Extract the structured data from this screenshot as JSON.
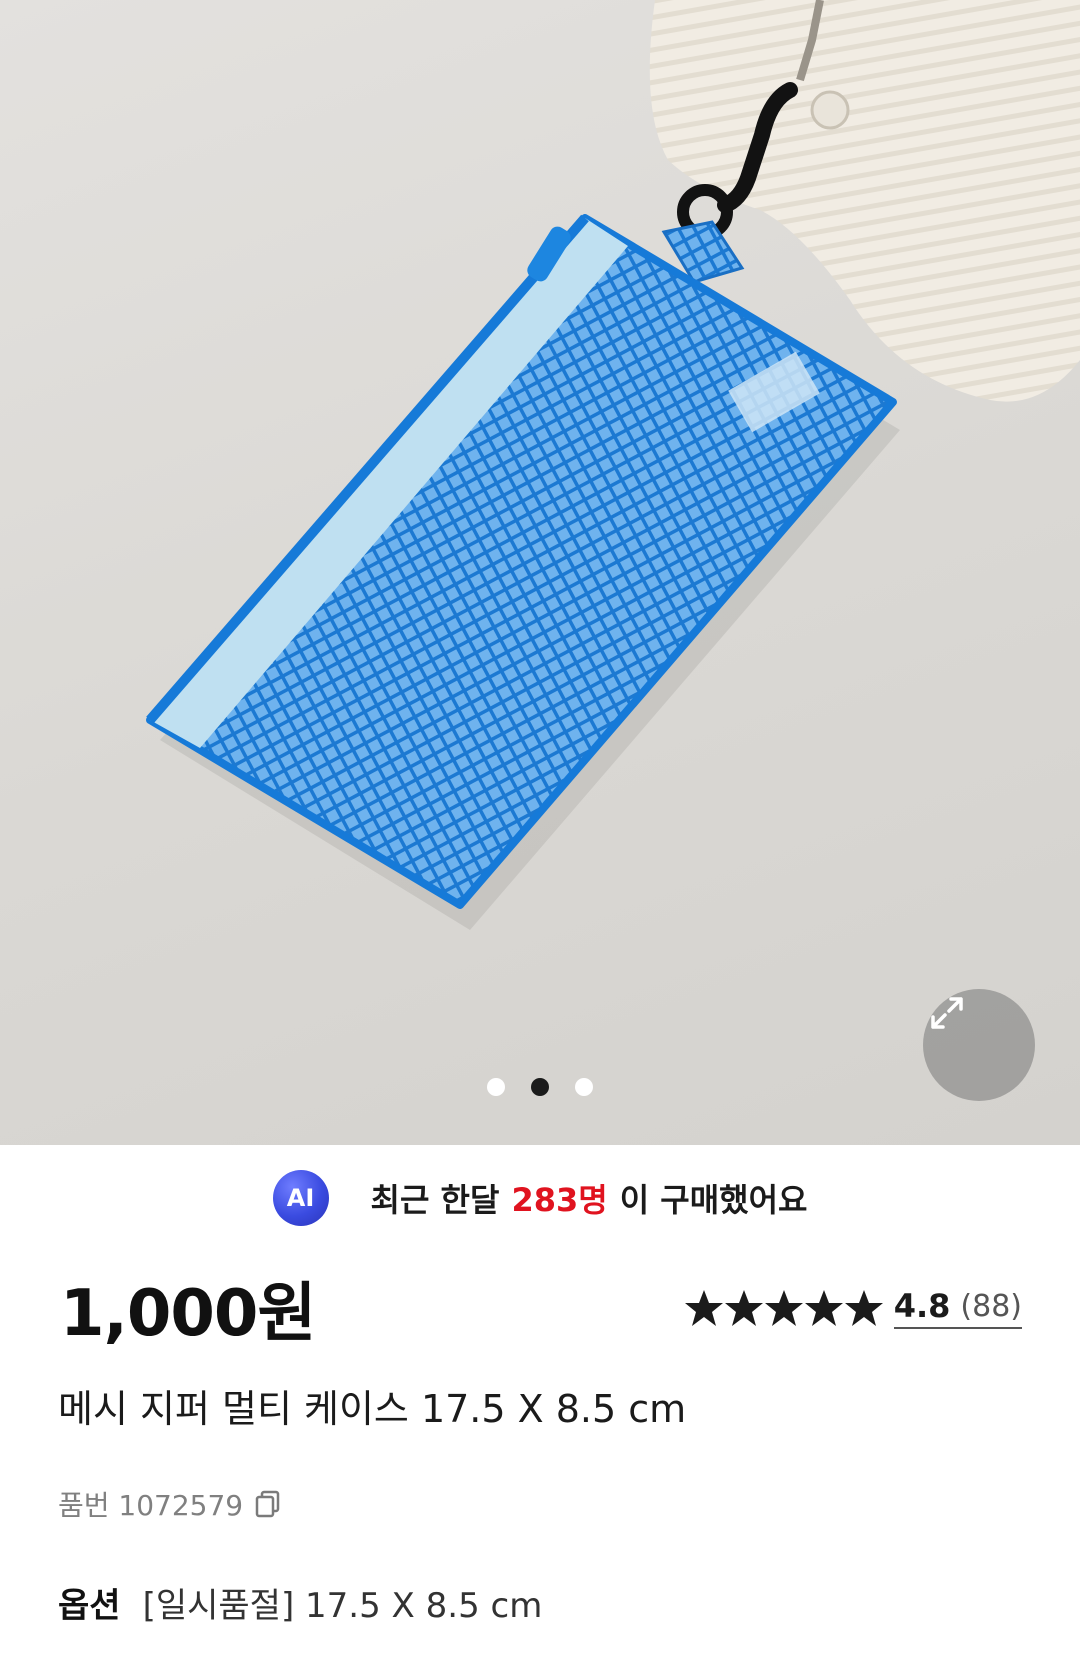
{
  "product": {
    "image_alt": "blue mesh zipper multi case",
    "gallery": {
      "page_count": 3,
      "active_index": 1
    },
    "purchase_banner": {
      "ai_badge": "AI",
      "prefix": "최근 한달",
      "count": "283명",
      "suffix": "이 구매했어요"
    },
    "price": "1,000원",
    "rating": {
      "score": "4.8",
      "count": "(88)",
      "stars": 5
    },
    "title": "메시 지퍼 멀티 케이스 17.5 X 8.5 cm",
    "sku": "품번 1072579",
    "option": {
      "label": "옵션",
      "value": "[일시품절] 17.5 X 8.5 cm"
    }
  },
  "colors": {
    "accent_red": "#e0131f",
    "ai_blue": "#3a4be0",
    "mesh_blue": "#1e7fd6"
  }
}
